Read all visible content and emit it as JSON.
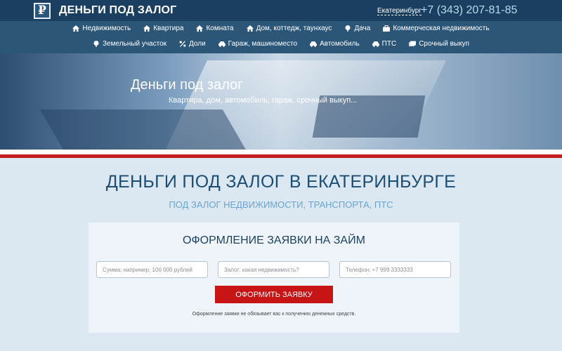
{
  "header": {
    "logo_glyph": "₽",
    "title": "ДЕНЬГИ ПОД ЗАЛОГ",
    "city": "Екатеринбург",
    "phone": "+7 (343) 207-81-85"
  },
  "nav": {
    "row1": [
      {
        "label": "Недвижимость",
        "icon": "house-icon"
      },
      {
        "label": "Квартира",
        "icon": "house-icon"
      },
      {
        "label": "Комната",
        "icon": "house-icon"
      },
      {
        "label": "Дом, коттедж, таунхаус",
        "icon": "house-icon"
      },
      {
        "label": "Дача",
        "icon": "tree-icon"
      },
      {
        "label": "Коммерческая недвижимость",
        "icon": "briefcase-icon"
      }
    ],
    "row2": [
      {
        "label": "Земельный участок",
        "icon": "tree-icon"
      },
      {
        "label": "Доли",
        "icon": "percent-icon"
      },
      {
        "label": "Гараж, машиноместо",
        "icon": "car-icon"
      },
      {
        "label": "Автомобиль",
        "icon": "car-icon"
      },
      {
        "label": "ПТС",
        "icon": "car-icon"
      },
      {
        "label": "Срочный выкуп",
        "icon": "money-icon"
      }
    ]
  },
  "hero": {
    "title": "Деньги под залог",
    "subtitle": "Квартира, дом, автомобиль, гараж, срочный выкуп..."
  },
  "main": {
    "heading": "ДЕНЬГИ ПОД ЗАЛОГ В ЕКАТЕРИНБУРГЕ",
    "subheading": "ПОД ЗАЛОГ НЕДВИЖИМОСТИ, ТРАНСПОРТА, ПТС"
  },
  "form": {
    "title": "ОФОРМЛЕНИЕ ЗАЯВКИ НА ЗАЙМ",
    "amount_placeholder": "Сумма: например, 100 000 рублей",
    "collateral_placeholder": "Залог: какая недвижимость?",
    "phone_placeholder": "Телефон: +7 999 3333333",
    "submit_label": "ОФОРМИТЬ ЗАЯВКУ",
    "note": "Оформление заявки не обязывает вас к получению денежных средств."
  },
  "colors": {
    "header_bg": "#1b3f60",
    "nav_bg": "#2b5678",
    "accent_red": "#c81414",
    "heading_blue": "#1c4d74"
  }
}
